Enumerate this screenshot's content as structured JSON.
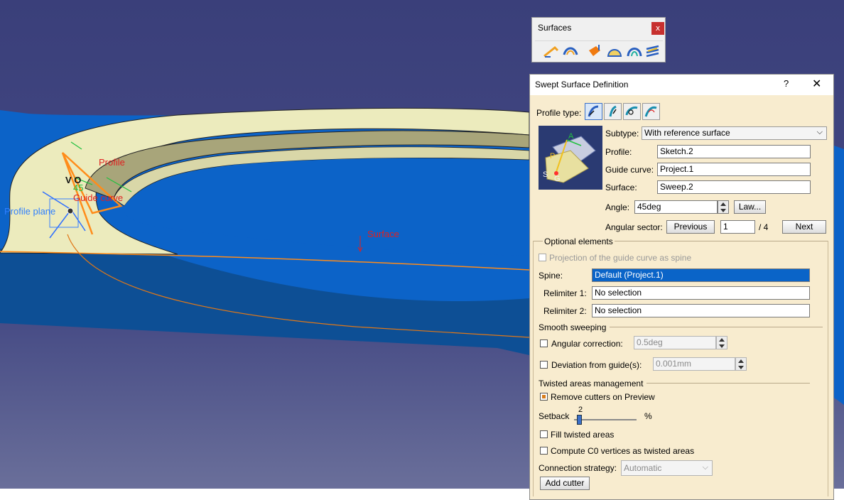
{
  "viewport": {
    "background_top": "#3a3f7a",
    "background_bottom": "#646a96",
    "labels": {
      "profile": "Profile",
      "angle": "45",
      "guide_curve": "Guide curve",
      "profile_plane": "Profile plane",
      "surface": "Surface",
      "vo": "V O"
    }
  },
  "surfaces_toolbar": {
    "title": "Surfaces",
    "close": "x",
    "icons": [
      "sweep-icon",
      "offset-icon",
      "extrude-icon",
      "fill-icon",
      "blend-icon",
      "multi-section-icon"
    ]
  },
  "dialog": {
    "title": "Swept Surface Definition",
    "help": "?",
    "close": "✕",
    "profile_type_label": "Profile type:",
    "profile_types": [
      "explicit-profile-icon",
      "line-profile-icon",
      "circle-profile-icon",
      "conic-profile-icon"
    ],
    "subtype_label": "Subtype:",
    "subtype_value": "With reference surface",
    "profile_label": "Profile:",
    "profile_value": "Sketch.2",
    "guide_curve_label": "Guide curve:",
    "guide_curve_value": "Project.1",
    "surface_label": "Surface:",
    "surface_value": "Sweep.2",
    "angle_label": "Angle:",
    "angle_value": "45deg",
    "law_button": "Law...",
    "angular_sector_label": "Angular sector:",
    "previous_button": "Previous",
    "sector_value": "1",
    "sector_total": "/ 4",
    "next_button": "Next",
    "illus": {
      "a": "A",
      "p": "P",
      "s": "S",
      "g": "G"
    },
    "optional_elements": {
      "title": "Optional elements",
      "projection_label": "Projection of the guide curve as spine",
      "spine_label": "Spine:",
      "spine_value": "Default (Project.1)",
      "relimiter1_label": "Relimiter 1:",
      "relimiter1_value": "No selection",
      "relimiter2_label": "Relimiter 2:",
      "relimiter2_value": "No selection"
    },
    "smooth_sweeping": {
      "title": "Smooth sweeping",
      "angular_correction_label": "Angular correction:",
      "angular_correction_value": "0.5deg",
      "deviation_label": "Deviation from guide(s):",
      "deviation_value": "0.001mm"
    },
    "twisted_areas": {
      "title": "Twisted areas management",
      "remove_cutters_label": "Remove cutters on Preview",
      "remove_cutters_checked": true,
      "setback_label": "Setback",
      "setback_value": "2",
      "setback_unit": "%",
      "setback_fraction": 0.02,
      "fill_twisted_label": "Fill twisted areas",
      "compute_c0_label": "Compute C0 vertices as twisted areas",
      "connection_strategy_label": "Connection strategy:",
      "connection_strategy_value": "Automatic",
      "add_cutter_button": "Add cutter"
    }
  }
}
